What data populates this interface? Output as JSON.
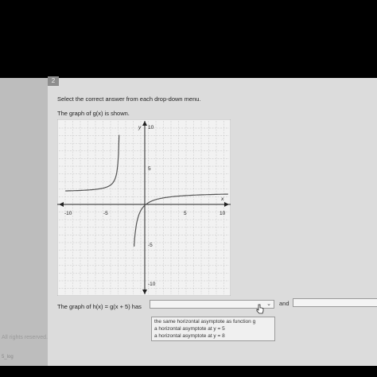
{
  "question": {
    "number": "2",
    "instructions": "Select the correct answer from each drop-down menu.",
    "graph_caption": "The graph of g(x) is shown."
  },
  "graph": {
    "x_ticks": [
      "-10",
      "-5",
      "5",
      "10"
    ],
    "y_ticks": [
      "10",
      "5",
      "-5",
      "-10"
    ],
    "x_axis_label": "x",
    "y_axis_label": "y"
  },
  "answer": {
    "prompt": "The graph of h(x) = g(x + 5) has",
    "selected_value": "",
    "options": [
      "the same horizontal asymptote as function g",
      "a horizontal asymptote at y = 5",
      "a horizontal asymptote at y = 8"
    ],
    "and_label": "and"
  },
  "footer": {
    "copyright": "All rights reserved.",
    "bottom_label": "5_log"
  }
}
